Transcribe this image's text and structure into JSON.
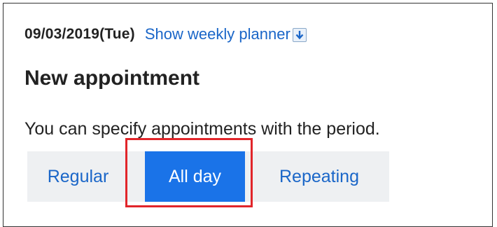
{
  "header": {
    "date": "09/03/2019(Tue)",
    "planner_link": "Show weekly planner",
    "planner_icon": "download-arrow-icon"
  },
  "page": {
    "title": "New appointment",
    "description": "You can specify appointments with the period."
  },
  "tabs": [
    {
      "label": "Regular",
      "selected": false
    },
    {
      "label": "All day",
      "selected": true
    },
    {
      "label": "Repeating",
      "selected": false
    }
  ],
  "colors": {
    "link": "#1a66c8",
    "selected_tab_bg": "#1a73e8",
    "tab_bar_bg": "#eef0f2",
    "highlight": "#e1252a"
  }
}
